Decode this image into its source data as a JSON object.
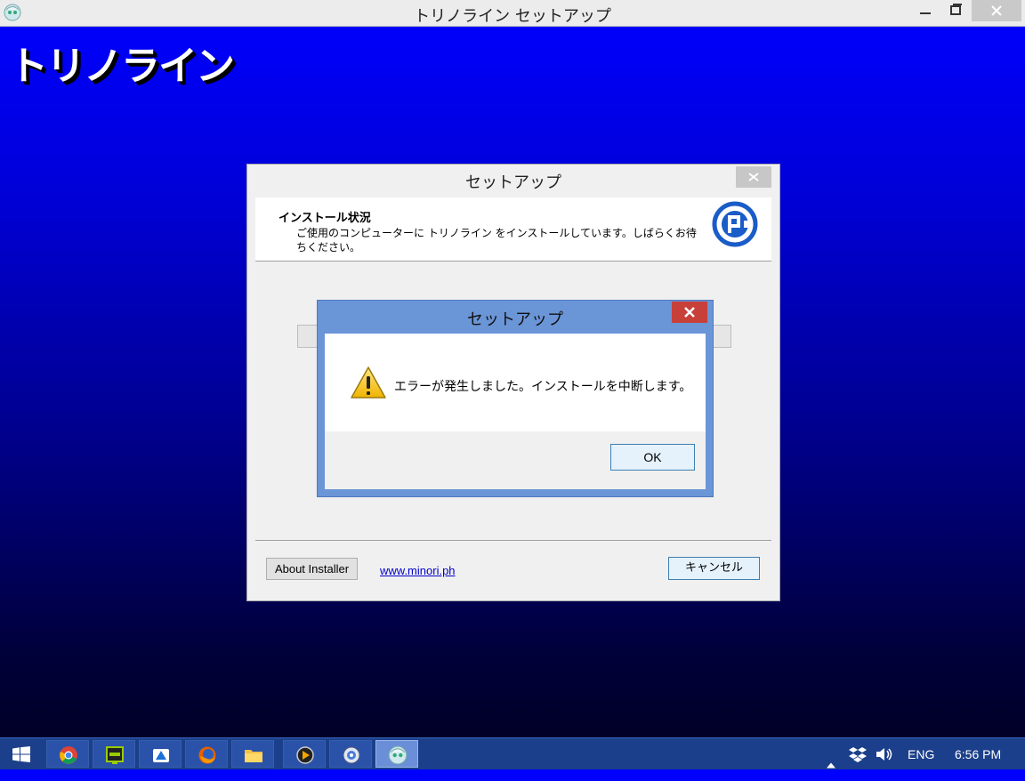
{
  "window": {
    "title": "トリノライン セットアップ"
  },
  "app_banner": "トリノライン",
  "setup_dialog": {
    "caption": "セットアップ",
    "header_title": "インストール状況",
    "header_sub": "ご使用のコンピューターに トリノライン をインストールしています。しばらくお待ちください。",
    "about_button": "About Installer",
    "link": "www.minori.ph",
    "cancel_button": "キャンセル"
  },
  "error_dialog": {
    "caption": "セットアップ",
    "message": "エラーが発生しました。インストールを中断します。",
    "ok_button": "OK"
  },
  "taskbar": {
    "language": "ENG",
    "time": "6:56 PM"
  },
  "colors": {
    "error_close": "#c7403a",
    "error_frame": "#6a95d7",
    "taskbar": "#1b3f8a",
    "link": "#0000cc"
  }
}
